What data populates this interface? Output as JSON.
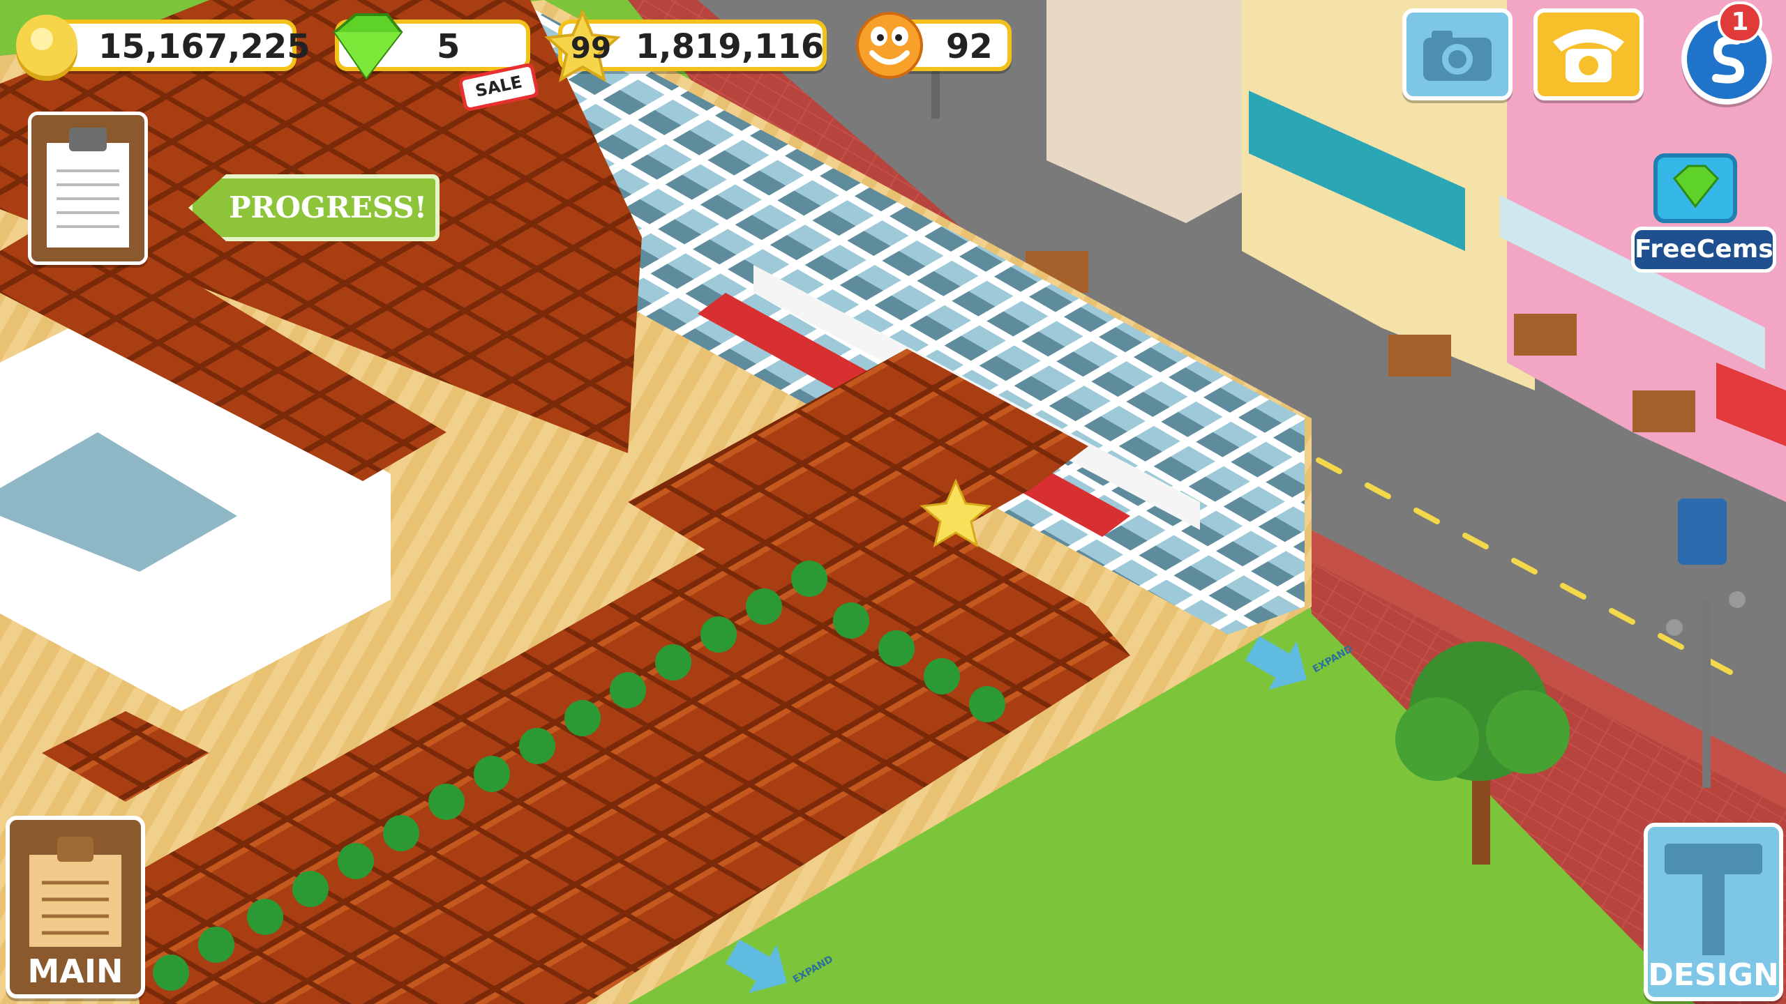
{
  "hud": {
    "coins": "15,167,225",
    "gems": "5",
    "level": "99",
    "xp": "1,819,116",
    "happiness": "92"
  },
  "sale_tag": "SALE",
  "progress_button": "PROGRESS!",
  "free_gems_button": "FreeCems",
  "notification_badge": "1",
  "main_button": "MAIN",
  "design_button": "DESIGN",
  "expand_label": "EXPAND",
  "colors": {
    "grass": "#7cc43a",
    "road": "#777777",
    "sidewalk": "#c0504a",
    "table_wood": "#a63a10",
    "hud_border": "#f3c21a",
    "design_button": "#7ec6e6"
  },
  "icons": [
    "coin-icon",
    "gem-icon",
    "level-star-icon",
    "happiness-face-icon",
    "camera-icon",
    "phone-icon",
    "social-icon",
    "clipboard-icon",
    "hammer-icon"
  ]
}
